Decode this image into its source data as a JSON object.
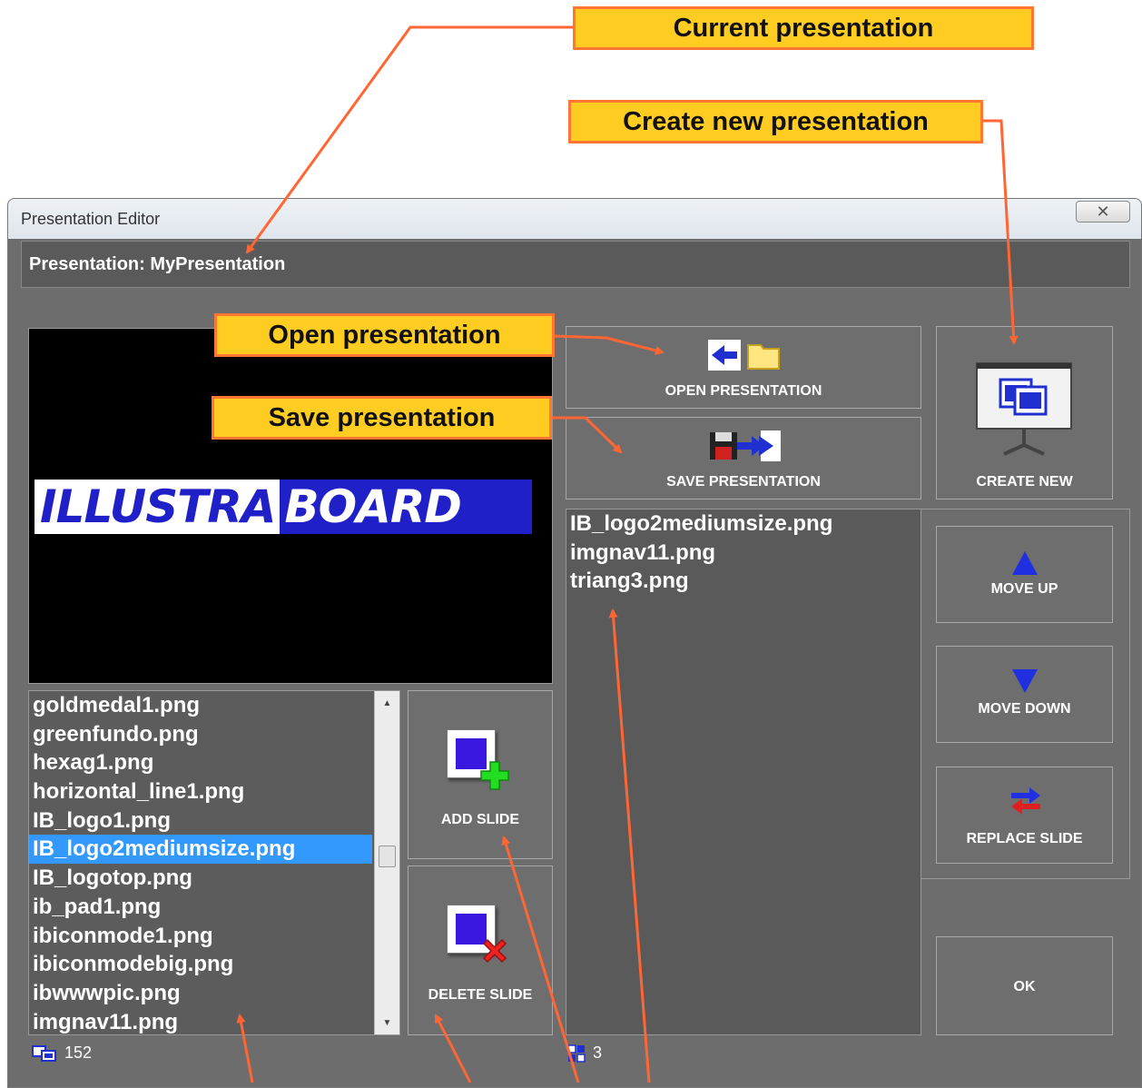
{
  "callouts": {
    "current": "Current presentation",
    "create_new": "Create new presentation",
    "open": "Open presentation",
    "save": "Save presentation"
  },
  "window": {
    "title": "Presentation Editor",
    "close_glyph": "✕"
  },
  "presentation_bar": "Presentation: MyPresentation",
  "preview": {
    "logo_part1": "ILLUSTRA",
    "logo_part2": "BOARD"
  },
  "file_list": {
    "items": [
      "goldmedal1.png",
      "greenfundo.png",
      "hexag1.png",
      "horizontal_line1.png",
      "IB_logo1.png",
      "IB_logo2mediumsize.png",
      "IB_logotop.png",
      "ib_pad1.png",
      "ibiconmode1.png",
      "ibiconmodebig.png",
      "ibwwwpic.png",
      "imgnav11.png"
    ],
    "selected": "IB_logo2mediumsize.png",
    "count": "152",
    "count_icon": "slides-icon"
  },
  "buttons": {
    "open": "OPEN PRESENTATION",
    "save": "SAVE PRESENTATION",
    "create_new": "CREATE NEW",
    "add_slide": "ADD SLIDE",
    "delete_slide": "DELETE SLIDE",
    "move_up": "MOVE UP",
    "move_down": "MOVE DOWN",
    "replace_slide": "REPLACE SLIDE",
    "ok": "OK"
  },
  "slide_list": {
    "items": [
      "IB_logo2mediumsize.png",
      "imgnav11.png",
      "triang3.png"
    ],
    "count": "3",
    "count_icon": "grid-icon"
  },
  "colors": {
    "callout_fill": "#ffcc22",
    "callout_border": "#ff7733",
    "arrow": "#ff6633",
    "window_bg": "#6d6d6d",
    "selection": "#3399ff",
    "icon_blue": "#2020c8"
  }
}
